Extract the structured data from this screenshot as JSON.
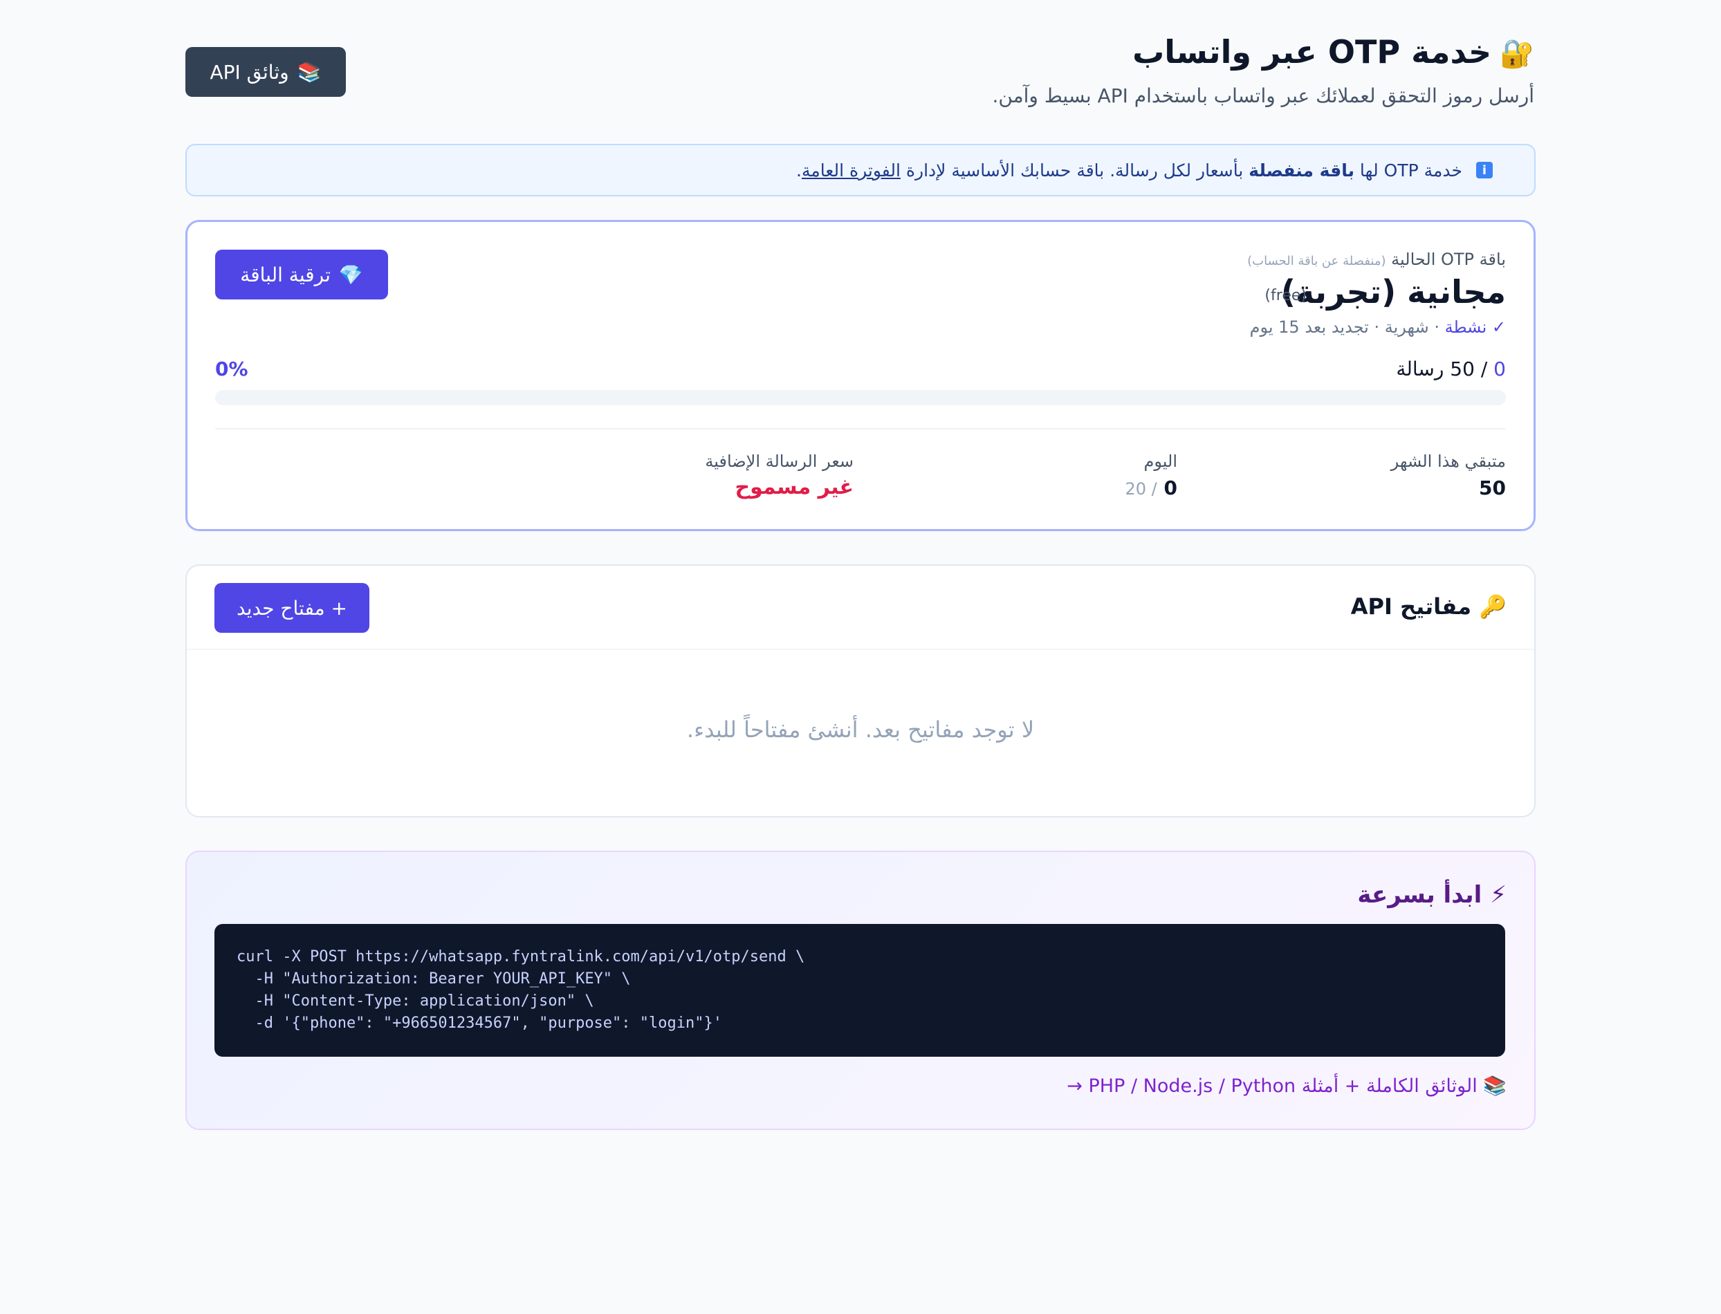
{
  "header": {
    "title_icon": "lock-icon",
    "title": "خدمة OTP عبر واتساب",
    "subtitle": "أرسل رموز التحقق لعملائك عبر واتساب باستخدام API بسيط وآمن.",
    "docs_button_icon": "books-icon",
    "docs_button": "وثائق API"
  },
  "banner": {
    "icon": "info-icon",
    "text_before": "خدمة OTP لها",
    "text_bold": "باقة منفصلة",
    "text_middle": "بأسعار لكل رسالة. باقة حسابك الأساسية لإدارة",
    "text_link": "الفوترة العامة",
    "text_end": "."
  },
  "plan": {
    "label": "باقة OTP الحالية",
    "label_note": "(منفصلة عن باقة الحساب)",
    "name": "مجانية (تجربة)",
    "code": "(free)",
    "status_active": "✓ نشطة",
    "status_rest": "· شهرية · تجديد بعد 15 يوم",
    "upgrade_icon": "gem-icon",
    "upgrade_button": "ترقية الباقة",
    "usage_used": "0",
    "usage_total": "/ 50 رسالة",
    "usage_percent_label": "0%",
    "usage_fraction": 0,
    "stats": {
      "remaining_label": "متبقي هذا الشهر",
      "remaining_value": "50",
      "today_label": "اليوم",
      "today_value": "0",
      "today_limit": "/ 20",
      "extra_price_label": "سعر الرسالة الإضافية",
      "extra_price_value": "غير مسموح"
    }
  },
  "keys": {
    "title_icon": "key-icon",
    "title": "مفاتيح API",
    "new_button": "+ مفتاح جديد",
    "empty": "لا توجد مفاتيح بعد. أنشئ مفتاحاً للبدء."
  },
  "quickstart": {
    "title_icon": "lightning-icon",
    "title": "ابدأ بسرعة",
    "code": "curl -X POST https://whatsapp.fyntralink.com/api/v1/otp/send \\\n  -H \"Authorization: Bearer YOUR_API_KEY\" \\\n  -H \"Content-Type: application/json\" \\\n  -d '{\"phone\": \"+966501234567\", \"purpose\": \"login\"}'",
    "docs_link_icon": "books-icon",
    "docs_link": "الوثائق الكاملة + أمثلة PHP / Node.js / Python →"
  },
  "colors": {
    "accent": "#4f46e5",
    "danger": "#e11d48",
    "dark_button": "#334155",
    "code_bg": "#0f172a"
  }
}
